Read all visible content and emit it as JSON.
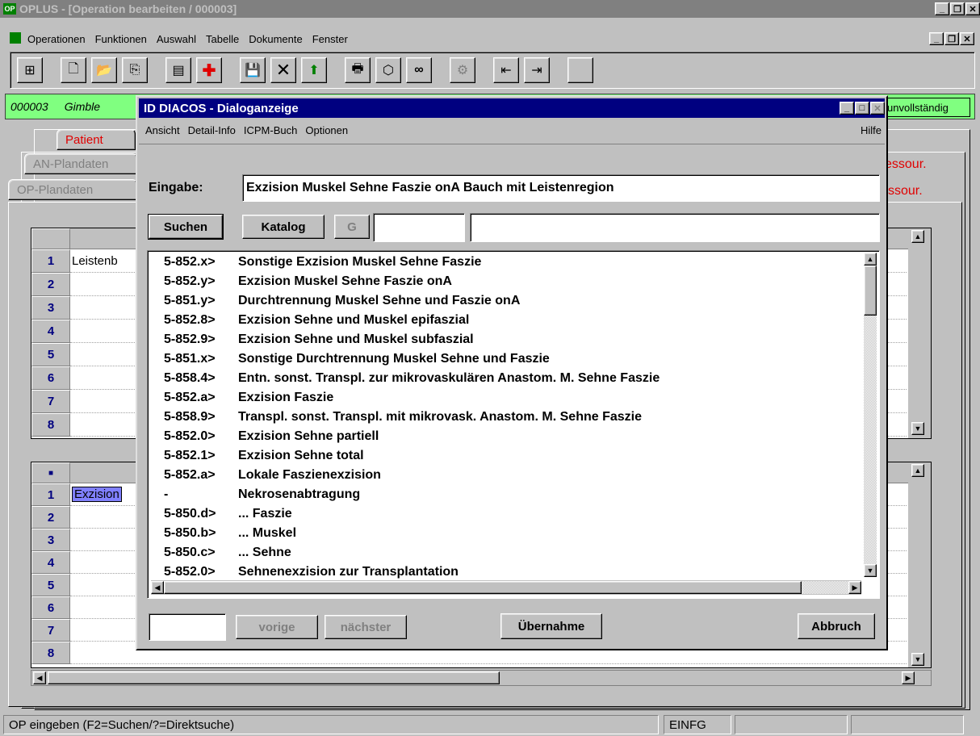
{
  "window": {
    "title": "OPLUS - [Operation bearbeiten / 000003]",
    "app_icon": "OP"
  },
  "menu": [
    "Operationen",
    "Funktionen",
    "Auswahl",
    "Tabelle",
    "Dokumente",
    "Fenster"
  ],
  "greenbar": {
    "id": "000003",
    "name": "Gimble",
    "status": "unvollständig"
  },
  "tabs": {
    "row1": [
      "Patient"
    ],
    "row2": [
      "AN-Plandaten"
    ],
    "row3": [
      "OP-Plandaten"
    ],
    "right1": "essour.",
    "right2": "ssour."
  },
  "grid1": {
    "rows": [
      "1",
      "2",
      "3",
      "4",
      "5",
      "6",
      "7",
      "8"
    ],
    "first_cell": "Leistenb"
  },
  "grid2": {
    "rows": [
      "1",
      "2",
      "3",
      "4",
      "5",
      "6",
      "7",
      "8"
    ],
    "first_cell": "Exzision",
    "corner": "■"
  },
  "dialog": {
    "title": "ID DIACOS - Dialoganzeige",
    "menu": [
      "Ansicht",
      "Detail-Info",
      "ICPM-Buch",
      "Optionen"
    ],
    "help": "Hilfe",
    "input_label": "Eingabe:",
    "input_value": "Exzision Muskel Sehne Faszie onA Bauch mit Leistenregion",
    "btn_search": "Suchen",
    "btn_catalog": "Katalog",
    "btn_g": "G",
    "results": [
      {
        "code": "5-852.x>",
        "text": "Sonstige Exzision Muskel Sehne Faszie"
      },
      {
        "code": "5-852.y>",
        "text": "Exzision Muskel Sehne Faszie onA"
      },
      {
        "code": "5-851.y>",
        "text": "Durchtrennung Muskel Sehne und Faszie onA"
      },
      {
        "code": "5-852.8>",
        "text": "Exzision Sehne und Muskel epifaszial"
      },
      {
        "code": "5-852.9>",
        "text": "Exzision Sehne und Muskel subfaszial"
      },
      {
        "code": "5-851.x>",
        "text": "Sonstige Durchtrennung Muskel Sehne und Faszie"
      },
      {
        "code": "5-858.4>",
        "text": "Entn. sonst. Transpl. zur mikrovaskulären Anastom. M. Sehne Faszie"
      },
      {
        "code": "5-852.a>",
        "text": "Exzision Faszie"
      },
      {
        "code": "5-858.9>",
        "text": "Transpl. sonst. Transpl. mit mikrovask. Anastom. M. Sehne Faszie"
      },
      {
        "code": "5-852.0>",
        "text": "Exzision Sehne partiell"
      },
      {
        "code": "5-852.1>",
        "text": "Exzision Sehne total"
      },
      {
        "code": "5-852.a>",
        "text": "Lokale Faszienexzision"
      },
      {
        "code": " -",
        "text": "Nekrosenabtragung"
      },
      {
        "code": "5-850.d>",
        "text": "... Faszie"
      },
      {
        "code": "5-850.b>",
        "text": "... Muskel"
      },
      {
        "code": "5-850.c>",
        "text": "... Sehne"
      },
      {
        "code": "5-852.0>",
        "text": "Sehnenexzision zur Transplantation"
      }
    ],
    "btn_prev": "vorige",
    "btn_next": "nächster",
    "btn_accept": "Übernahme",
    "btn_cancel": "Abbruch"
  },
  "status": {
    "hint": "OP eingeben (F2=Suchen/?=Direktsuche)",
    "mode": "EINFG"
  }
}
